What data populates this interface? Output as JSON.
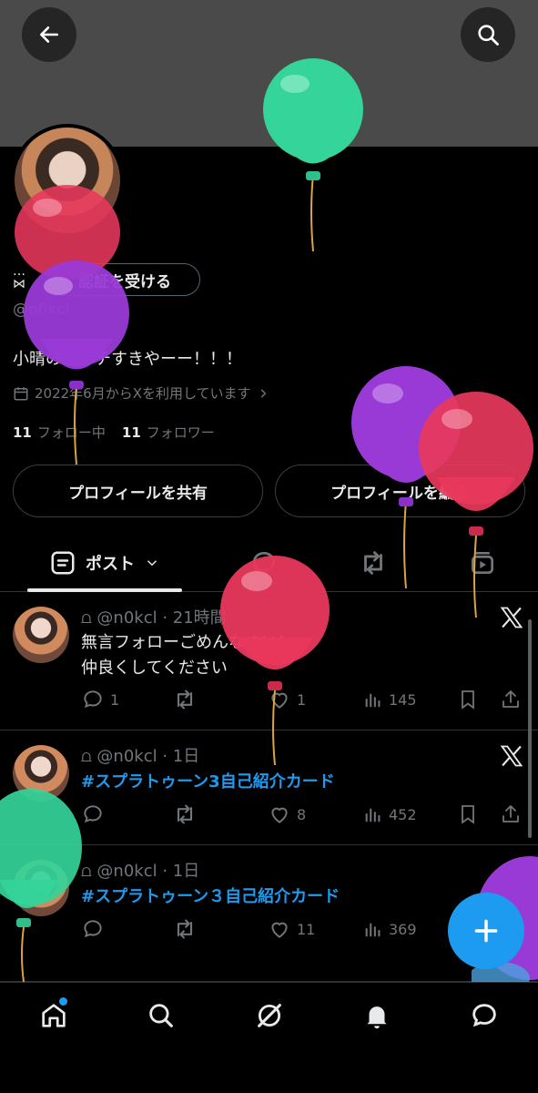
{
  "header": {
    "back_icon": "arrow-left-icon",
    "search_icon": "search-icon"
  },
  "profile": {
    "name_glyph": "…",
    "name_sub": "⋈",
    "verify_label": "認証を受ける",
    "handle": "@n0kcl",
    "bio": "小晴のかガチすきやーー！！！",
    "joined": "2022年6月からXを利用しています",
    "following_count": "11",
    "following_label": "フォロー中",
    "followers_count": "11",
    "followers_label": "フォロワー",
    "share_label": "プロフィールを共有",
    "edit_label": "プロフィールを編集"
  },
  "tabs": {
    "posts_label": "ポスト"
  },
  "posts": [
    {
      "head": "⩍ @n0kcl · 21時間",
      "text_line1": "無言フォローごめんなさい！",
      "text_line2": "仲良くしてください",
      "replies": "1",
      "likes": "1",
      "views": "145"
    },
    {
      "head": "⩍ @n0kcl · 1日",
      "hashtag": "#スプラトゥーン3自己紹介カード",
      "likes": "8",
      "views": "452"
    },
    {
      "head": "⩍ @n0kcl · 1日",
      "hashtag": "#スプラトゥーン３自己紹介カード",
      "likes": "11",
      "views": "369"
    }
  ],
  "colors": {
    "background": "#000000",
    "banner": "#4a4a4a",
    "accent": "#1d9bf0",
    "muted_text": "#71767b",
    "balloon_green": "#34d49a",
    "balloon_red": "#e8385c",
    "balloon_purple": "#9a3ad6"
  }
}
